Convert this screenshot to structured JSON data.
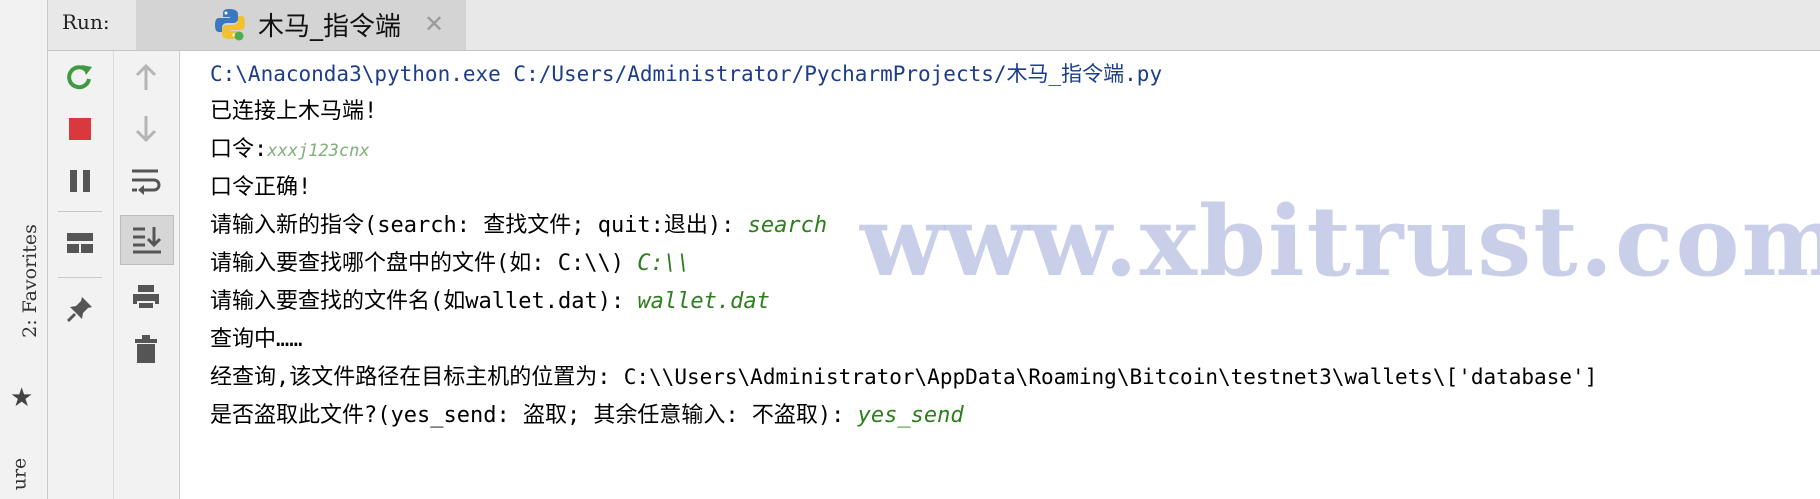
{
  "side_bar": {
    "favorites_label": "2: Favorites",
    "structure_label_fragment": "ure"
  },
  "run_window": {
    "label": "Run:",
    "tab": {
      "title": "木马_指令端",
      "icon": "python-file-icon",
      "close_icon": "close-icon"
    }
  },
  "toolbar_left": [
    {
      "name": "rerun-button",
      "icon": "rerun-icon",
      "color": "#3e9a3e"
    },
    {
      "name": "stop-button",
      "icon": "stop-icon",
      "color": "#d9393c"
    },
    {
      "name": "pause-button",
      "icon": "pause-icon"
    },
    {
      "name": "restore-layout-button",
      "icon": "layout-icon"
    },
    {
      "name": "pin-tab-button",
      "icon": "pin-icon"
    }
  ],
  "toolbar_right": [
    {
      "name": "up-stack-button",
      "icon": "arrow-up-icon"
    },
    {
      "name": "down-stack-button",
      "icon": "arrow-down-icon"
    },
    {
      "name": "soft-wrap-button",
      "icon": "soft-wrap-icon"
    },
    {
      "name": "scroll-to-end-button",
      "icon": "scroll-to-end-icon"
    },
    {
      "name": "print-button",
      "icon": "print-icon"
    },
    {
      "name": "clear-all-button",
      "icon": "trash-icon"
    }
  ],
  "console": {
    "command": "C:\\Anaconda3\\python.exe C:/Users/Administrator/PycharmProjects/木马_指令端.py",
    "lines": {
      "connected": "已连接上木马端!",
      "password_prompt": "口令:",
      "password_input": "xxxj123cnx",
      "password_ok": "口令正确!",
      "cmd_prompt": "请输入新的指令(search: 查找文件; quit:退出):",
      "cmd_input": "search",
      "disk_prompt": "请输入要查找哪个盘中的文件(如: C:\\\\)",
      "disk_input": "C:\\\\",
      "file_prompt": "请输入要查找的文件名(如wallet.dat):",
      "file_input": "wallet.dat",
      "searching": "查询中……",
      "result_prefix": "经查询,该文件路径在目标主机的位置为:",
      "result_path": "C:\\\\Users\\Administrator\\AppData\\Roaming\\Bitcoin\\testnet3\\wallets\\['database']",
      "steal_prompt": "是否盗取此文件?(yes_send: 盗取; 其余任意输入: 不盗取):",
      "steal_input": "yes_send"
    },
    "input_color": "#2e7d1e",
    "command_color": "#1c3d8c"
  },
  "watermark": "www.xbitrust.com"
}
